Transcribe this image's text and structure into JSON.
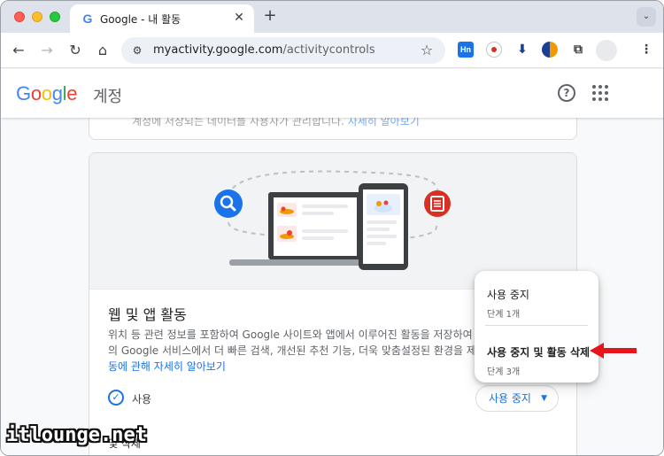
{
  "browser": {
    "tab_title": "Google - 내 활동",
    "tab_favicon": "G",
    "new_tab_label": "+",
    "url_host": "myactivity.google.com",
    "url_path": "/activitycontrols",
    "extensions": [
      "Hn"
    ]
  },
  "header": {
    "logo": [
      "G",
      "o",
      "o",
      "g",
      "l",
      "e"
    ],
    "account_label": "계정"
  },
  "previous_card": {
    "text": "계정에 저장되는 데이터를 사용자가 관리합니다.",
    "link": "자세히 알아보기"
  },
  "card": {
    "title": "웹 및 앱 활동",
    "desc_line1": "위치 등 관련 정보를 포함하여 Google 사이트와 앱에서 이루어진 활동을 저장하여 지도",
    "desc_line2": "의 Google 서비스에서 더 빠른 검색, 개선된 추천 기능, 더욱 맞춤설정된 환경을 제공합니",
    "desc_link": "동에 관해 자세히 알아보기",
    "status_label": "사용",
    "stop_button_label": "사용 중지",
    "sub_item_label": "및 삭제"
  },
  "menu": {
    "items": [
      {
        "label": "사용 중지",
        "sub": "단계 1개"
      },
      {
        "label": "사용 중지 및 활동 삭제",
        "sub": "단계 3개"
      }
    ]
  },
  "watermark": "itlounge.net",
  "colors": {
    "google_blue": "#4285f4",
    "google_red": "#ea4335",
    "google_yellow": "#fbbc05",
    "google_green": "#34a853",
    "link_blue": "#1a73e8",
    "arrow_red": "#e8141b"
  }
}
